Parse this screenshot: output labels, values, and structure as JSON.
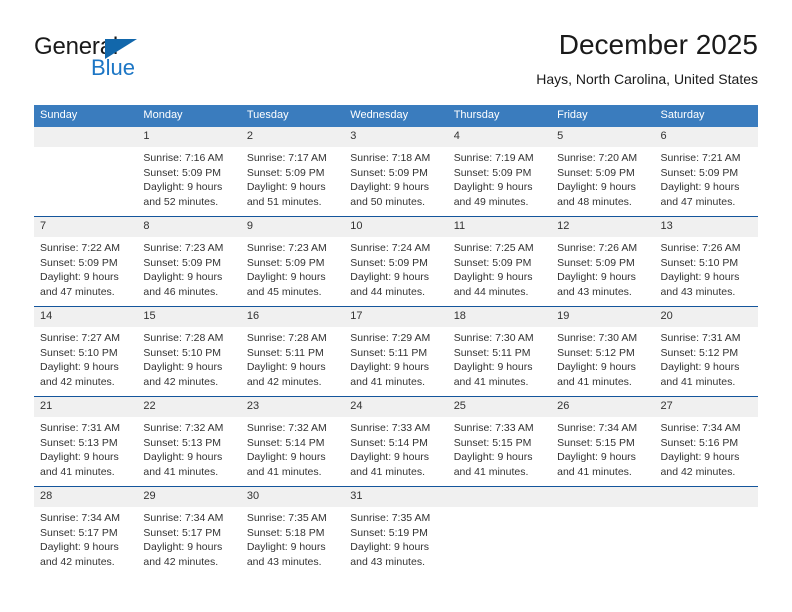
{
  "brand": {
    "name_part1": "General",
    "name_part2": "Blue"
  },
  "header": {
    "month_title": "December 2025",
    "location": "Hays, North Carolina, United States"
  },
  "colors": {
    "header_row": "#3a7cbe",
    "row_divider": "#15559c",
    "daynum_band": "#f0f0f0",
    "brand_blue": "#1c76c5"
  },
  "weekday_headers": [
    "Sunday",
    "Monday",
    "Tuesday",
    "Wednesday",
    "Thursday",
    "Friday",
    "Saturday"
  ],
  "weeks": [
    [
      {
        "day": "",
        "sunrise": "",
        "sunset": "",
        "daylight1": "",
        "daylight2": ""
      },
      {
        "day": "1",
        "sunrise": "Sunrise: 7:16 AM",
        "sunset": "Sunset: 5:09 PM",
        "daylight1": "Daylight: 9 hours",
        "daylight2": "and 52 minutes."
      },
      {
        "day": "2",
        "sunrise": "Sunrise: 7:17 AM",
        "sunset": "Sunset: 5:09 PM",
        "daylight1": "Daylight: 9 hours",
        "daylight2": "and 51 minutes."
      },
      {
        "day": "3",
        "sunrise": "Sunrise: 7:18 AM",
        "sunset": "Sunset: 5:09 PM",
        "daylight1": "Daylight: 9 hours",
        "daylight2": "and 50 minutes."
      },
      {
        "day": "4",
        "sunrise": "Sunrise: 7:19 AM",
        "sunset": "Sunset: 5:09 PM",
        "daylight1": "Daylight: 9 hours",
        "daylight2": "and 49 minutes."
      },
      {
        "day": "5",
        "sunrise": "Sunrise: 7:20 AM",
        "sunset": "Sunset: 5:09 PM",
        "daylight1": "Daylight: 9 hours",
        "daylight2": "and 48 minutes."
      },
      {
        "day": "6",
        "sunrise": "Sunrise: 7:21 AM",
        "sunset": "Sunset: 5:09 PM",
        "daylight1": "Daylight: 9 hours",
        "daylight2": "and 47 minutes."
      }
    ],
    [
      {
        "day": "7",
        "sunrise": "Sunrise: 7:22 AM",
        "sunset": "Sunset: 5:09 PM",
        "daylight1": "Daylight: 9 hours",
        "daylight2": "and 47 minutes."
      },
      {
        "day": "8",
        "sunrise": "Sunrise: 7:23 AM",
        "sunset": "Sunset: 5:09 PM",
        "daylight1": "Daylight: 9 hours",
        "daylight2": "and 46 minutes."
      },
      {
        "day": "9",
        "sunrise": "Sunrise: 7:23 AM",
        "sunset": "Sunset: 5:09 PM",
        "daylight1": "Daylight: 9 hours",
        "daylight2": "and 45 minutes."
      },
      {
        "day": "10",
        "sunrise": "Sunrise: 7:24 AM",
        "sunset": "Sunset: 5:09 PM",
        "daylight1": "Daylight: 9 hours",
        "daylight2": "and 44 minutes."
      },
      {
        "day": "11",
        "sunrise": "Sunrise: 7:25 AM",
        "sunset": "Sunset: 5:09 PM",
        "daylight1": "Daylight: 9 hours",
        "daylight2": "and 44 minutes."
      },
      {
        "day": "12",
        "sunrise": "Sunrise: 7:26 AM",
        "sunset": "Sunset: 5:09 PM",
        "daylight1": "Daylight: 9 hours",
        "daylight2": "and 43 minutes."
      },
      {
        "day": "13",
        "sunrise": "Sunrise: 7:26 AM",
        "sunset": "Sunset: 5:10 PM",
        "daylight1": "Daylight: 9 hours",
        "daylight2": "and 43 minutes."
      }
    ],
    [
      {
        "day": "14",
        "sunrise": "Sunrise: 7:27 AM",
        "sunset": "Sunset: 5:10 PM",
        "daylight1": "Daylight: 9 hours",
        "daylight2": "and 42 minutes."
      },
      {
        "day": "15",
        "sunrise": "Sunrise: 7:28 AM",
        "sunset": "Sunset: 5:10 PM",
        "daylight1": "Daylight: 9 hours",
        "daylight2": "and 42 minutes."
      },
      {
        "day": "16",
        "sunrise": "Sunrise: 7:28 AM",
        "sunset": "Sunset: 5:11 PM",
        "daylight1": "Daylight: 9 hours",
        "daylight2": "and 42 minutes."
      },
      {
        "day": "17",
        "sunrise": "Sunrise: 7:29 AM",
        "sunset": "Sunset: 5:11 PM",
        "daylight1": "Daylight: 9 hours",
        "daylight2": "and 41 minutes."
      },
      {
        "day": "18",
        "sunrise": "Sunrise: 7:30 AM",
        "sunset": "Sunset: 5:11 PM",
        "daylight1": "Daylight: 9 hours",
        "daylight2": "and 41 minutes."
      },
      {
        "day": "19",
        "sunrise": "Sunrise: 7:30 AM",
        "sunset": "Sunset: 5:12 PM",
        "daylight1": "Daylight: 9 hours",
        "daylight2": "and 41 minutes."
      },
      {
        "day": "20",
        "sunrise": "Sunrise: 7:31 AM",
        "sunset": "Sunset: 5:12 PM",
        "daylight1": "Daylight: 9 hours",
        "daylight2": "and 41 minutes."
      }
    ],
    [
      {
        "day": "21",
        "sunrise": "Sunrise: 7:31 AM",
        "sunset": "Sunset: 5:13 PM",
        "daylight1": "Daylight: 9 hours",
        "daylight2": "and 41 minutes."
      },
      {
        "day": "22",
        "sunrise": "Sunrise: 7:32 AM",
        "sunset": "Sunset: 5:13 PM",
        "daylight1": "Daylight: 9 hours",
        "daylight2": "and 41 minutes."
      },
      {
        "day": "23",
        "sunrise": "Sunrise: 7:32 AM",
        "sunset": "Sunset: 5:14 PM",
        "daylight1": "Daylight: 9 hours",
        "daylight2": "and 41 minutes."
      },
      {
        "day": "24",
        "sunrise": "Sunrise: 7:33 AM",
        "sunset": "Sunset: 5:14 PM",
        "daylight1": "Daylight: 9 hours",
        "daylight2": "and 41 minutes."
      },
      {
        "day": "25",
        "sunrise": "Sunrise: 7:33 AM",
        "sunset": "Sunset: 5:15 PM",
        "daylight1": "Daylight: 9 hours",
        "daylight2": "and 41 minutes."
      },
      {
        "day": "26",
        "sunrise": "Sunrise: 7:34 AM",
        "sunset": "Sunset: 5:15 PM",
        "daylight1": "Daylight: 9 hours",
        "daylight2": "and 41 minutes."
      },
      {
        "day": "27",
        "sunrise": "Sunrise: 7:34 AM",
        "sunset": "Sunset: 5:16 PM",
        "daylight1": "Daylight: 9 hours",
        "daylight2": "and 42 minutes."
      }
    ],
    [
      {
        "day": "28",
        "sunrise": "Sunrise: 7:34 AM",
        "sunset": "Sunset: 5:17 PM",
        "daylight1": "Daylight: 9 hours",
        "daylight2": "and 42 minutes."
      },
      {
        "day": "29",
        "sunrise": "Sunrise: 7:34 AM",
        "sunset": "Sunset: 5:17 PM",
        "daylight1": "Daylight: 9 hours",
        "daylight2": "and 42 minutes."
      },
      {
        "day": "30",
        "sunrise": "Sunrise: 7:35 AM",
        "sunset": "Sunset: 5:18 PM",
        "daylight1": "Daylight: 9 hours",
        "daylight2": "and 43 minutes."
      },
      {
        "day": "31",
        "sunrise": "Sunrise: 7:35 AM",
        "sunset": "Sunset: 5:19 PM",
        "daylight1": "Daylight: 9 hours",
        "daylight2": "and 43 minutes."
      },
      {
        "day": "",
        "sunrise": "",
        "sunset": "",
        "daylight1": "",
        "daylight2": ""
      },
      {
        "day": "",
        "sunrise": "",
        "sunset": "",
        "daylight1": "",
        "daylight2": ""
      },
      {
        "day": "",
        "sunrise": "",
        "sunset": "",
        "daylight1": "",
        "daylight2": ""
      }
    ]
  ]
}
